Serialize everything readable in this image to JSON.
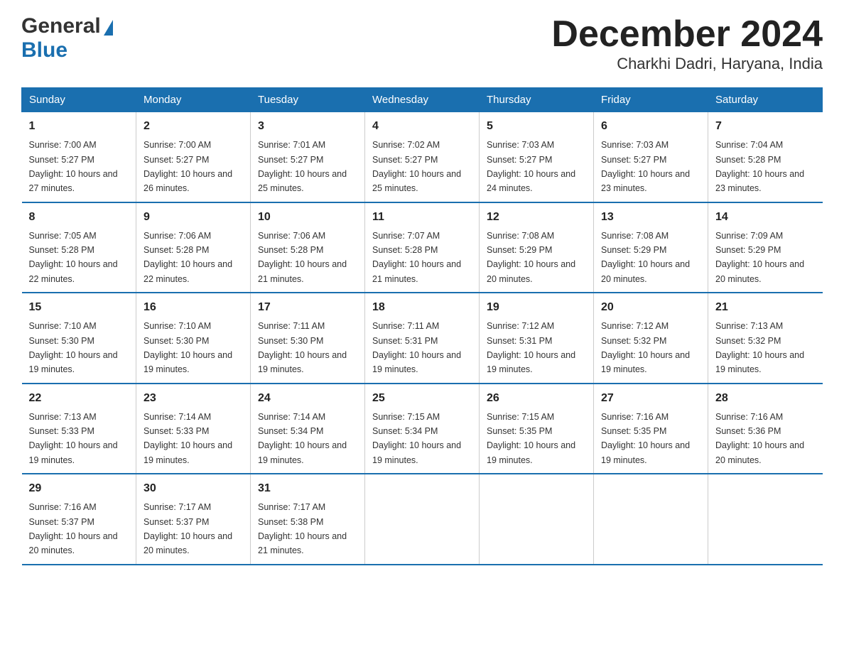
{
  "logo": {
    "text_general": "General",
    "text_blue": "Blue"
  },
  "title": "December 2024",
  "subtitle": "Charkhi Dadri, Haryana, India",
  "days_of_week": [
    "Sunday",
    "Monday",
    "Tuesday",
    "Wednesday",
    "Thursday",
    "Friday",
    "Saturday"
  ],
  "weeks": [
    [
      {
        "day": "1",
        "sunrise": "7:00 AM",
        "sunset": "5:27 PM",
        "daylight": "10 hours and 27 minutes."
      },
      {
        "day": "2",
        "sunrise": "7:00 AM",
        "sunset": "5:27 PM",
        "daylight": "10 hours and 26 minutes."
      },
      {
        "day": "3",
        "sunrise": "7:01 AM",
        "sunset": "5:27 PM",
        "daylight": "10 hours and 25 minutes."
      },
      {
        "day": "4",
        "sunrise": "7:02 AM",
        "sunset": "5:27 PM",
        "daylight": "10 hours and 25 minutes."
      },
      {
        "day": "5",
        "sunrise": "7:03 AM",
        "sunset": "5:27 PM",
        "daylight": "10 hours and 24 minutes."
      },
      {
        "day": "6",
        "sunrise": "7:03 AM",
        "sunset": "5:27 PM",
        "daylight": "10 hours and 23 minutes."
      },
      {
        "day": "7",
        "sunrise": "7:04 AM",
        "sunset": "5:28 PM",
        "daylight": "10 hours and 23 minutes."
      }
    ],
    [
      {
        "day": "8",
        "sunrise": "7:05 AM",
        "sunset": "5:28 PM",
        "daylight": "10 hours and 22 minutes."
      },
      {
        "day": "9",
        "sunrise": "7:06 AM",
        "sunset": "5:28 PM",
        "daylight": "10 hours and 22 minutes."
      },
      {
        "day": "10",
        "sunrise": "7:06 AM",
        "sunset": "5:28 PM",
        "daylight": "10 hours and 21 minutes."
      },
      {
        "day": "11",
        "sunrise": "7:07 AM",
        "sunset": "5:28 PM",
        "daylight": "10 hours and 21 minutes."
      },
      {
        "day": "12",
        "sunrise": "7:08 AM",
        "sunset": "5:29 PM",
        "daylight": "10 hours and 20 minutes."
      },
      {
        "day": "13",
        "sunrise": "7:08 AM",
        "sunset": "5:29 PM",
        "daylight": "10 hours and 20 minutes."
      },
      {
        "day": "14",
        "sunrise": "7:09 AM",
        "sunset": "5:29 PM",
        "daylight": "10 hours and 20 minutes."
      }
    ],
    [
      {
        "day": "15",
        "sunrise": "7:10 AM",
        "sunset": "5:30 PM",
        "daylight": "10 hours and 19 minutes."
      },
      {
        "day": "16",
        "sunrise": "7:10 AM",
        "sunset": "5:30 PM",
        "daylight": "10 hours and 19 minutes."
      },
      {
        "day": "17",
        "sunrise": "7:11 AM",
        "sunset": "5:30 PM",
        "daylight": "10 hours and 19 minutes."
      },
      {
        "day": "18",
        "sunrise": "7:11 AM",
        "sunset": "5:31 PM",
        "daylight": "10 hours and 19 minutes."
      },
      {
        "day": "19",
        "sunrise": "7:12 AM",
        "sunset": "5:31 PM",
        "daylight": "10 hours and 19 minutes."
      },
      {
        "day": "20",
        "sunrise": "7:12 AM",
        "sunset": "5:32 PM",
        "daylight": "10 hours and 19 minutes."
      },
      {
        "day": "21",
        "sunrise": "7:13 AM",
        "sunset": "5:32 PM",
        "daylight": "10 hours and 19 minutes."
      }
    ],
    [
      {
        "day": "22",
        "sunrise": "7:13 AM",
        "sunset": "5:33 PM",
        "daylight": "10 hours and 19 minutes."
      },
      {
        "day": "23",
        "sunrise": "7:14 AM",
        "sunset": "5:33 PM",
        "daylight": "10 hours and 19 minutes."
      },
      {
        "day": "24",
        "sunrise": "7:14 AM",
        "sunset": "5:34 PM",
        "daylight": "10 hours and 19 minutes."
      },
      {
        "day": "25",
        "sunrise": "7:15 AM",
        "sunset": "5:34 PM",
        "daylight": "10 hours and 19 minutes."
      },
      {
        "day": "26",
        "sunrise": "7:15 AM",
        "sunset": "5:35 PM",
        "daylight": "10 hours and 19 minutes."
      },
      {
        "day": "27",
        "sunrise": "7:16 AM",
        "sunset": "5:35 PM",
        "daylight": "10 hours and 19 minutes."
      },
      {
        "day": "28",
        "sunrise": "7:16 AM",
        "sunset": "5:36 PM",
        "daylight": "10 hours and 20 minutes."
      }
    ],
    [
      {
        "day": "29",
        "sunrise": "7:16 AM",
        "sunset": "5:37 PM",
        "daylight": "10 hours and 20 minutes."
      },
      {
        "day": "30",
        "sunrise": "7:17 AM",
        "sunset": "5:37 PM",
        "daylight": "10 hours and 20 minutes."
      },
      {
        "day": "31",
        "sunrise": "7:17 AM",
        "sunset": "5:38 PM",
        "daylight": "10 hours and 21 minutes."
      },
      null,
      null,
      null,
      null
    ]
  ]
}
